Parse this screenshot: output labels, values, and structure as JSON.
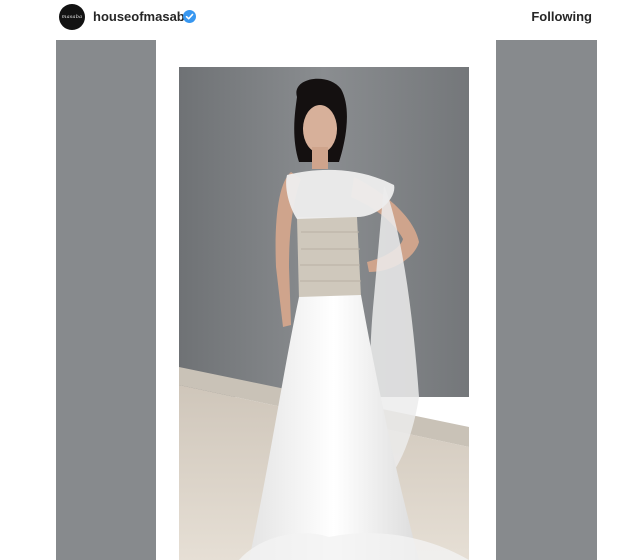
{
  "post_header": {
    "username": "houseofmasaba",
    "follow_state": "Following",
    "avatar_icon": "brand-logo-icon",
    "verified_icon": "verified-badge-icon"
  },
  "post": {
    "image_subject": "photo",
    "colors": {
      "wall": "#7f8285",
      "floor": "#d9d1c6",
      "side_panels": "#878a8d",
      "verified_badge": "#3897f0"
    }
  }
}
